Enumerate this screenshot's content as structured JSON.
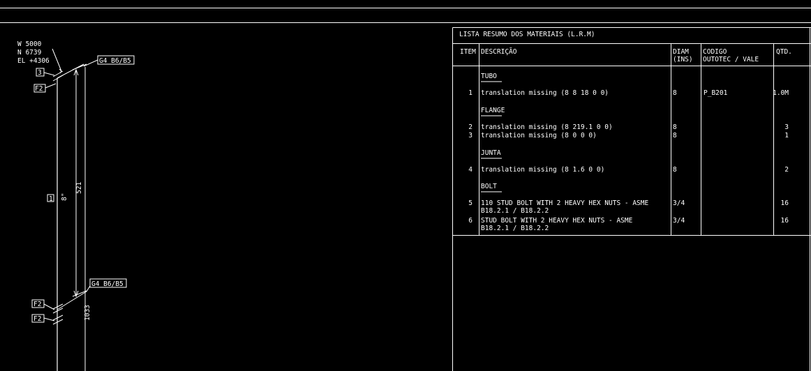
{
  "drawing": {
    "coords": {
      "w": "W 5000",
      "n": "N 6739",
      "el": "EL +4306"
    },
    "tags": {
      "weld_top": "3",
      "flange_top": "F2",
      "flange_bottom_1": "F2",
      "flange_bottom_2": "F2",
      "spool": "1"
    },
    "callouts": {
      "top": "G4 B6/B5",
      "bottom": "G4 B6/B5"
    },
    "dims": {
      "length_1": "521",
      "length_2": "1033",
      "pipe_size": "8\""
    }
  },
  "bom": {
    "title": "LISTA RESUMO DOS MATERIAIS (L.R.M)",
    "headers": {
      "item": "ITEM",
      "desc": "DESCRIÇÃO",
      "diam_1": "DIAM",
      "diam_2": "(INS)",
      "code_1": "CODIGO",
      "code_2": "OUTOTEC / VALE",
      "qty": "QTD."
    },
    "groups": [
      {
        "name": "TUBO",
        "rows": [
          {
            "item": "1",
            "desc": [
              "translation missing (8 8 18 0 0)"
            ],
            "diam": "8",
            "code": "P_B201",
            "qty": "1.0M"
          }
        ]
      },
      {
        "name": "FLANGE",
        "rows": [
          {
            "item": "2",
            "desc": [
              "translation missing (8 219.1 0 0)"
            ],
            "diam": "8",
            "code": "",
            "qty": "3"
          },
          {
            "item": "3",
            "desc": [
              "translation missing (8 0 0 0)"
            ],
            "diam": "8",
            "code": "",
            "qty": "1"
          }
        ]
      },
      {
        "name": "JUNTA",
        "rows": [
          {
            "item": "4",
            "desc": [
              "translation missing (8 1.6 0 0)"
            ],
            "diam": "8",
            "code": "",
            "qty": "2"
          }
        ]
      },
      {
        "name": "BOLT",
        "rows": [
          {
            "item": "5",
            "desc": [
              "110 STUD BOLT WITH 2 HEAVY HEX NUTS - ASME",
              "B18.2.1 / B18.2.2"
            ],
            "diam": "3/4",
            "code": "",
            "qty": "16"
          },
          {
            "item": "6",
            "desc": [
              "STUD BOLT WITH 2 HEAVY HEX NUTS - ASME",
              "B18.2.1 / B18.2.2"
            ],
            "diam": "3/4",
            "code": "",
            "qty": "16"
          }
        ]
      }
    ]
  }
}
